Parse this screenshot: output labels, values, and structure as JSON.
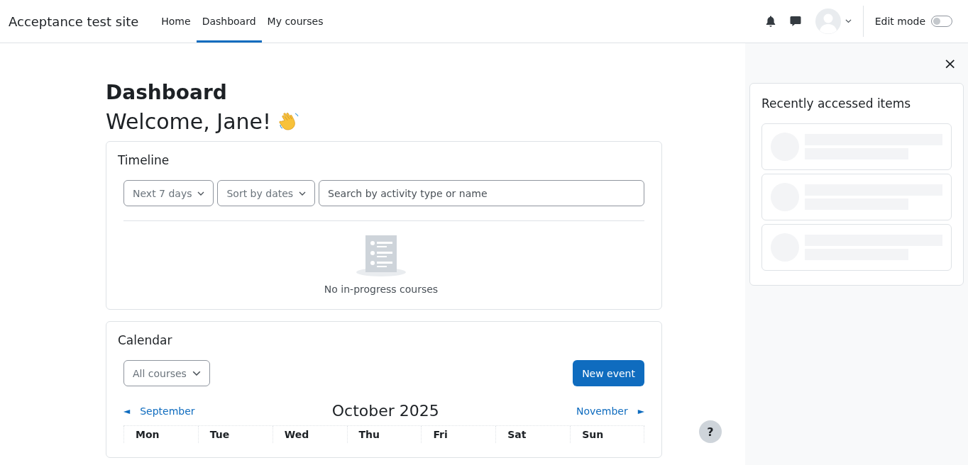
{
  "site_name": "Acceptance test site",
  "nav": [
    {
      "label": "Home",
      "selected": false
    },
    {
      "label": "Dashboard",
      "selected": true
    },
    {
      "label": "My courses",
      "selected": false
    }
  ],
  "edit_mode": {
    "label": "Edit mode",
    "on": false
  },
  "page_title": "Dashboard",
  "welcome": "Welcome, Jane!",
  "timeline": {
    "title": "Timeline",
    "filters": [
      "Next 7 days",
      "Sort by dates"
    ],
    "search": {
      "placeholder": "Search by activity type or name"
    },
    "empty_message": "No in-progress courses"
  },
  "calendar": {
    "title": "Calendar",
    "course_filter": "All courses",
    "new_event": "New event",
    "prev_arrow": "◄",
    "prev": "September",
    "month": "October 2025",
    "next": "November",
    "next_arrow": "►",
    "weekdays": [
      "Mon",
      "Tue",
      "Wed",
      "Thu",
      "Fri",
      "Sat",
      "Sun"
    ]
  },
  "help": "?",
  "drawer": {
    "close": "×",
    "title": "Recently accessed items",
    "items": [
      {
        "kind": "placeholder"
      },
      {
        "kind": "placeholder"
      },
      {
        "kind": "placeholder"
      }
    ]
  }
}
